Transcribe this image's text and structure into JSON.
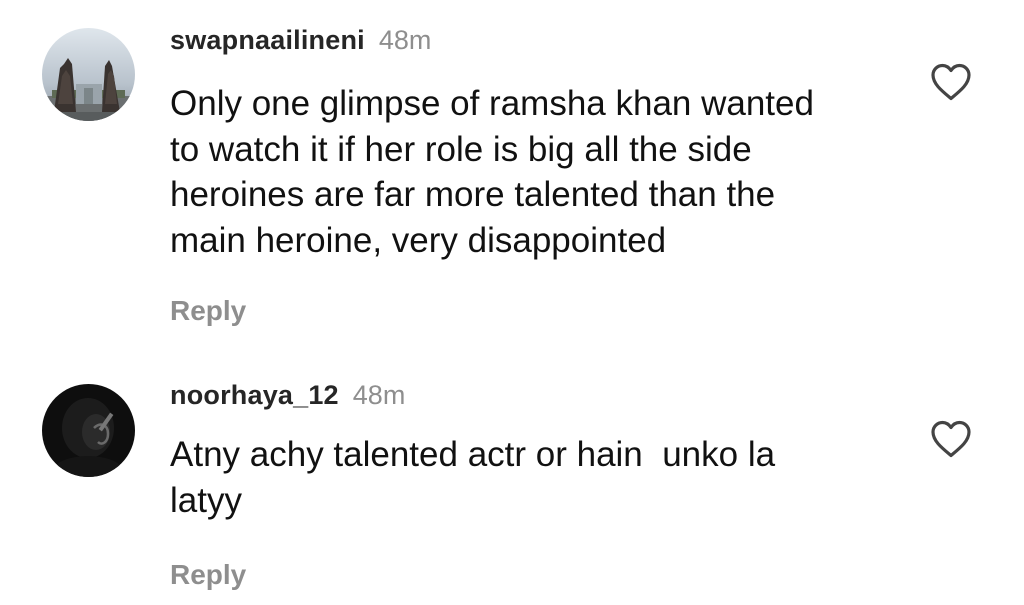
{
  "comments": [
    {
      "username": "swapnaailineni",
      "time": "48m",
      "text": "Only one glimpse of ramsha khan wanted\nto watch it if her role is big all the side\nheroines are far more talented than the\nmain heroine, very disappointed",
      "reply_label": "Reply",
      "avatar_icon": "temple-gate-photo-avatar",
      "like_icon": "heart-outline-icon"
    },
    {
      "username": "noorhaya_12",
      "time": "48m",
      "text": "Atny achy talented actr or hain  unko la\nlatyy",
      "reply_label": "Reply",
      "avatar_icon": "dark-portrait-avatar",
      "like_icon": "heart-outline-icon"
    }
  ],
  "colors": {
    "text": "#111111",
    "username": "#262626",
    "muted": "#8e8e8e",
    "background": "#ffffff"
  }
}
